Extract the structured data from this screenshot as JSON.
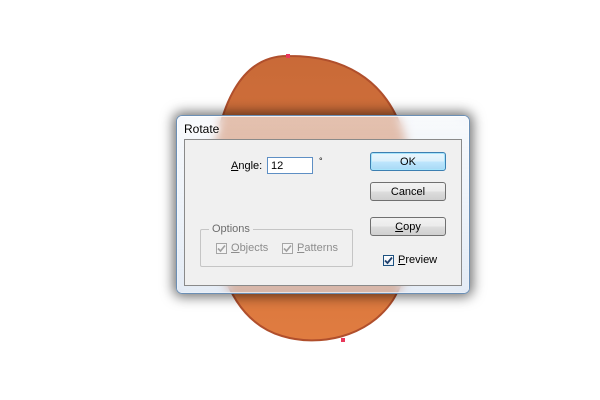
{
  "dialog": {
    "title": "Rotate",
    "angle": {
      "label": "Angle:",
      "value": "12",
      "unit": "°"
    },
    "options": {
      "title": "Options",
      "objects": {
        "label": "Objects",
        "checked": true,
        "enabled": false
      },
      "patterns": {
        "label": "Patterns",
        "checked": true,
        "enabled": false
      }
    },
    "buttons": {
      "ok": "OK",
      "cancel": "Cancel",
      "copy": "Copy"
    },
    "preview": {
      "label": "Preview",
      "checked": true
    }
  },
  "colors": {
    "shape_fill": "#d9773f",
    "shape_stroke": "#b04f2c",
    "anchor_points": "#e8385a",
    "dialog_border": "#6b8fb5",
    "default_button_border": "#3c7fb1",
    "input_border": "#5e8fc4"
  }
}
